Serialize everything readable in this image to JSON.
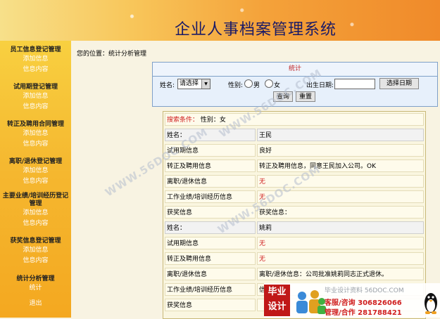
{
  "header": {
    "title": "企业人事档案管理系统"
  },
  "sidebar": {
    "groups": [
      {
        "title": "员工信息登记管理",
        "items": [
          "添加信息",
          "信息内容"
        ]
      },
      {
        "title": "试用期登记管理",
        "items": [
          "添加信息",
          "信息内容"
        ]
      },
      {
        "title": "转正及聘用合同管理",
        "items": [
          "添加信息",
          "信息内容"
        ]
      },
      {
        "title": "离职/退休登记管理",
        "items": [
          "添加信息",
          "信息内容"
        ]
      },
      {
        "title": "主要业绩/培训经历登记管理",
        "items": [
          "添加信息",
          "信息内容"
        ]
      },
      {
        "title": "获奖信息登记管理",
        "items": [
          "添加信息",
          "信息内容"
        ]
      },
      {
        "title": "统计分析管理",
        "items": [
          "统计"
        ]
      },
      {
        "title": "",
        "items": [
          "退出"
        ]
      }
    ]
  },
  "breadcrumb": "您的位置：统计分析管理",
  "stat": {
    "header": "统计",
    "name_label": "姓名:",
    "name_select": "请选择",
    "gender_label": "性别:",
    "male": "男",
    "female": "女",
    "birth_label": "出生日期:",
    "birth_value": "",
    "pick_date_label": "选择日期",
    "query_label": "查询",
    "reset_label": "重置"
  },
  "results": {
    "search_label": "搜索条件：",
    "search_value": "性别：女",
    "rows": [
      {
        "label": "姓名：",
        "value": "王民",
        "type": "name"
      },
      {
        "label": "试用期信息",
        "value": "良好"
      },
      {
        "label": "转正及聘用信息",
        "value": "转正及聘用信息，同意王民加入公司。OK"
      },
      {
        "label": "离职/退休信息",
        "value": "无",
        "red": true
      },
      {
        "label": "工作业绩/培训经历信息",
        "value": "无",
        "red": true
      },
      {
        "label": "获奖信息",
        "value": "获奖信息："
      },
      {
        "label": "姓名：",
        "value": "姚莉",
        "type": "name"
      },
      {
        "label": "试用期信息",
        "value": "无",
        "red": true
      },
      {
        "label": "转正及聘用信息",
        "value": "无",
        "red": true
      },
      {
        "label": "离职/退休信息",
        "value": "离职/退休信息：公司批准姚莉同志正式退休。"
      },
      {
        "label": "工作业绩/培训经历信息",
        "value": "信息：ok"
      },
      {
        "label": "获奖信息",
        "value": ""
      }
    ]
  },
  "watermarks": [
    "WWW.56DOC.COM",
    "WWW.56DOC.COM",
    "WWW.56DOC.COM"
  ],
  "ad": {
    "logo_top": "毕业",
    "logo_bottom": "设计",
    "line1": "毕业设计资料 56DOC.COM",
    "line2_label": "客服/咨询",
    "line2_value": "306826066",
    "line3_label": "管理/合作",
    "line3_value": "281788421"
  },
  "colors": {
    "accent_red": "#d02020",
    "title_blue": "#1a1a66"
  }
}
